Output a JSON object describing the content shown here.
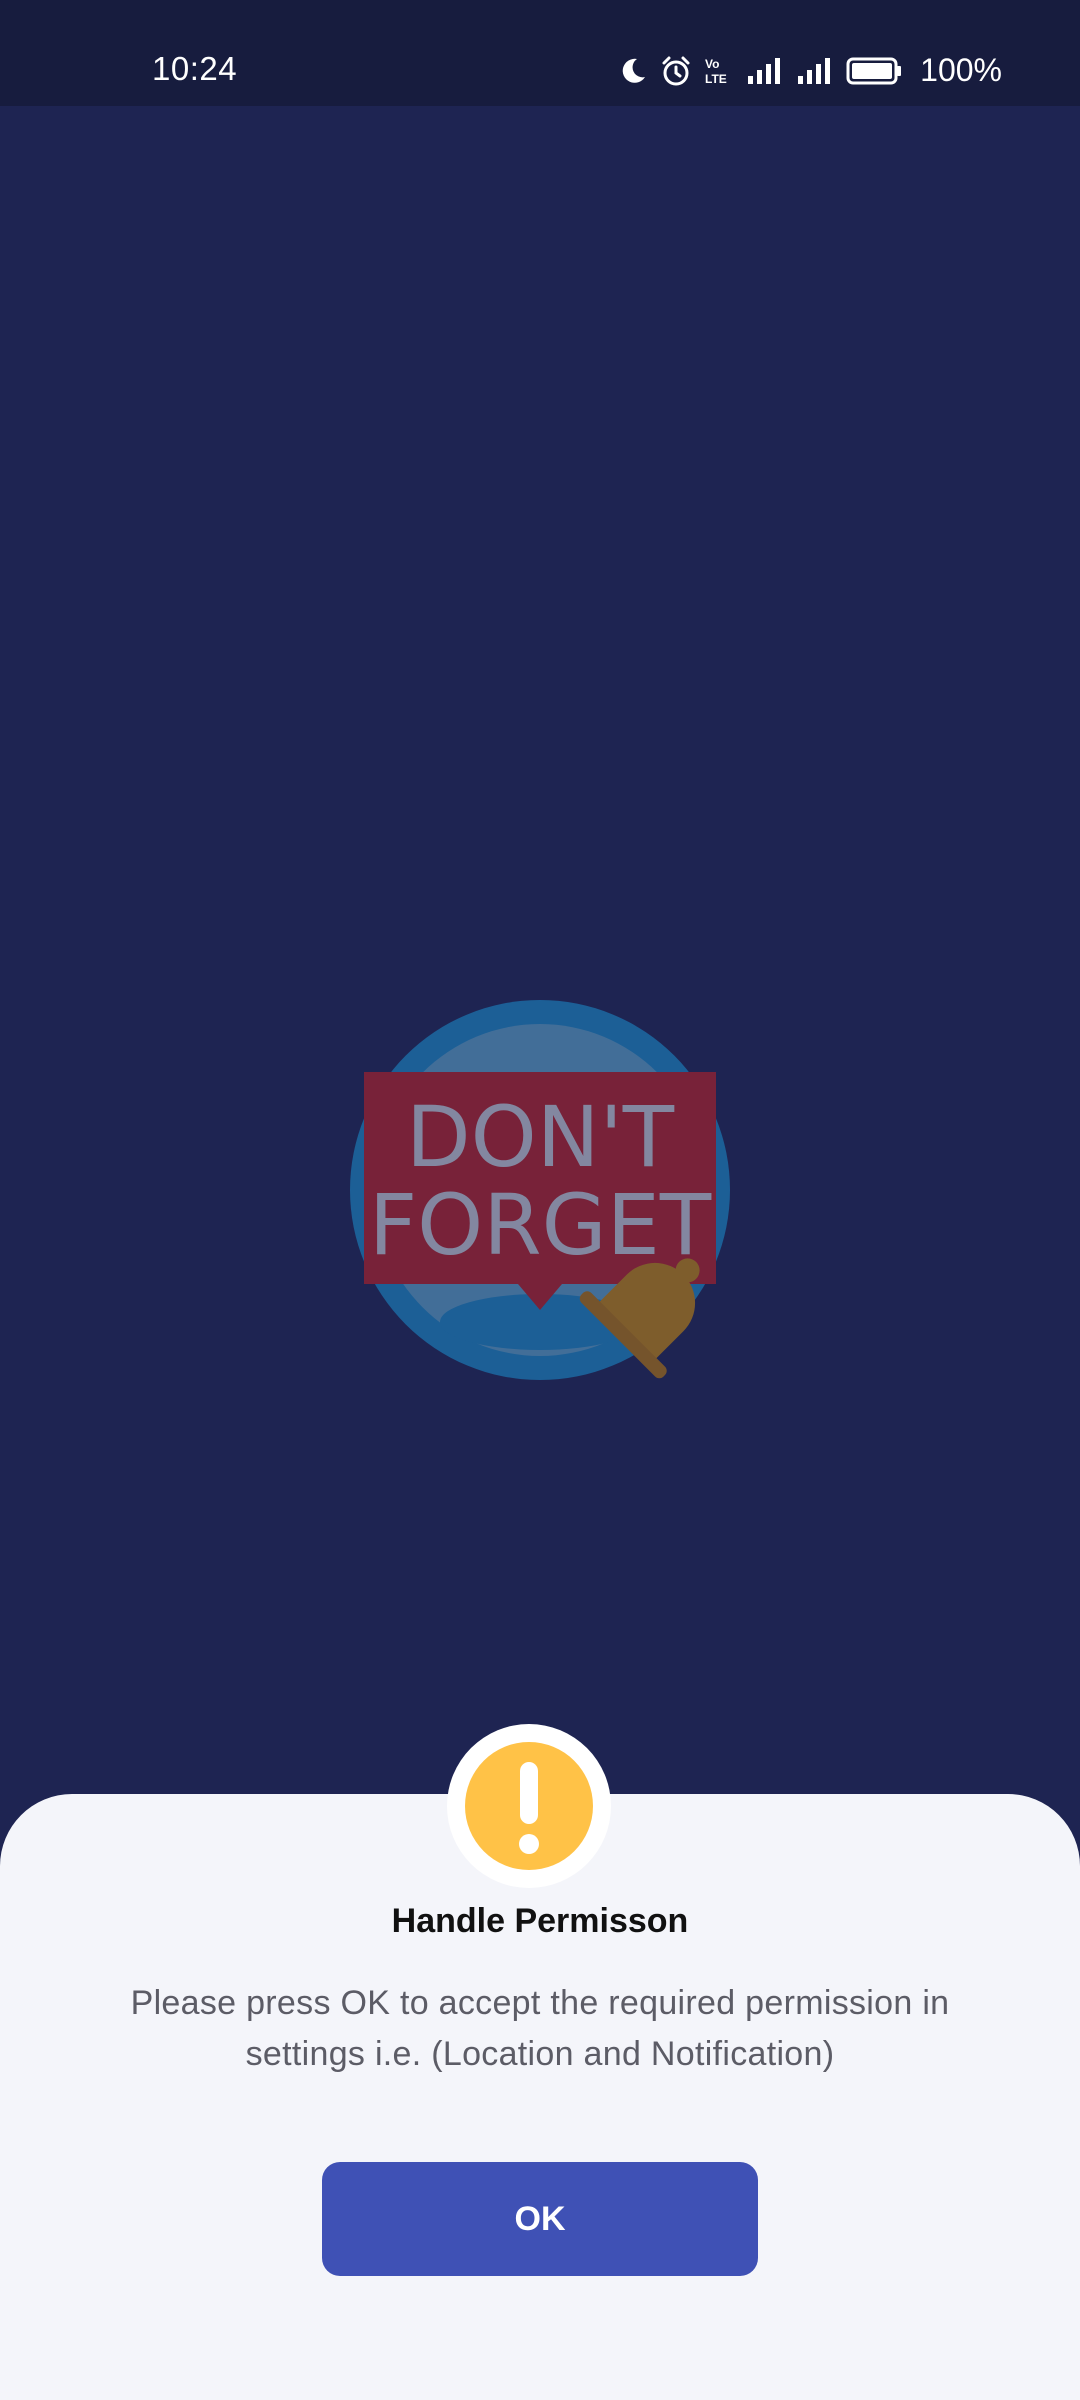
{
  "status_bar": {
    "time": "10:24",
    "icons": [
      "moon-icon",
      "alarm-icon",
      "volte-icon",
      "signal-icon",
      "signal-icon",
      "battery-icon"
    ],
    "volte_label": "Vo LTE",
    "battery_percent": "100%"
  },
  "app": {
    "logo": {
      "line1": "DON'T",
      "line2": "FORGET",
      "icon": "bell-icon"
    }
  },
  "dialog": {
    "icon": "exclamation-icon",
    "title": "Handle Permisson",
    "message": "Please press OK to accept the required permission in settings i.e. (Location and Notification)",
    "ok_label": "OK",
    "colors": {
      "button": "#3f51b5",
      "badge": "#ffc247",
      "sheet": "#f4f5fa",
      "background": "#1e2452"
    }
  }
}
